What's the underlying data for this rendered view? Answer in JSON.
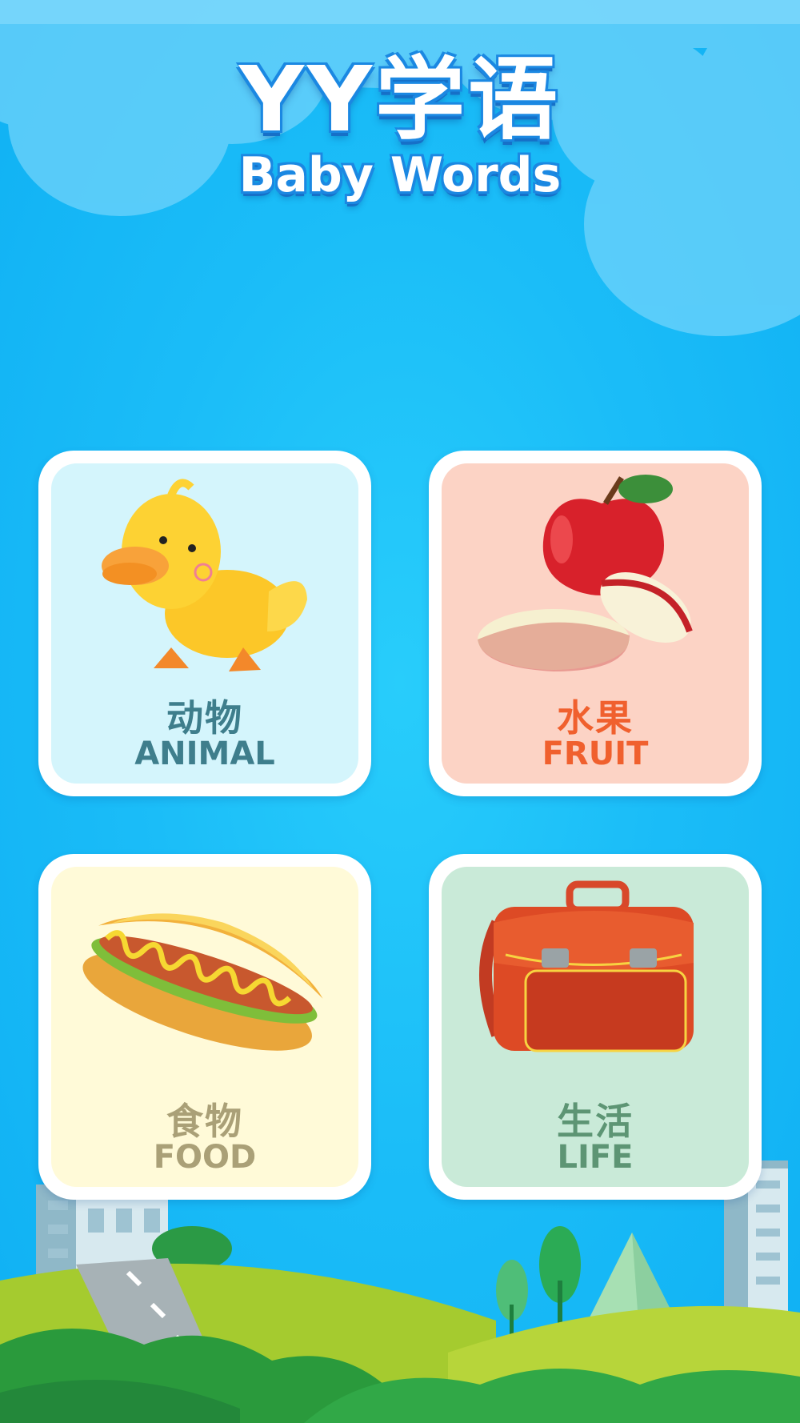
{
  "header": {
    "title_cn": "YY学语",
    "title_en": "Baby Words"
  },
  "categories": [
    {
      "id": "animal",
      "label_cn": "动物",
      "label_en": "ANIMAL",
      "icon": "duck-icon",
      "bg": "#d4f5fc",
      "text_color": "#3e7e8c"
    },
    {
      "id": "fruit",
      "label_cn": "水果",
      "label_en": "FRUIT",
      "icon": "apple-icon",
      "bg": "#fcd3c5",
      "text_color": "#f0602e"
    },
    {
      "id": "food",
      "label_cn": "食物",
      "label_en": "FOOD",
      "icon": "hotdog-icon",
      "bg": "#fffad8",
      "text_color": "#aaa077"
    },
    {
      "id": "life",
      "label_cn": "生活",
      "label_en": "LIFE",
      "icon": "backpack-icon",
      "bg": "#c9ead8",
      "text_color": "#5d9574"
    }
  ],
  "colors": {
    "sky": "#1bbdf8",
    "title_outline": "#1b88e2",
    "hill_light": "#a5cb2f",
    "hill_dark": "#2a9a3c"
  }
}
